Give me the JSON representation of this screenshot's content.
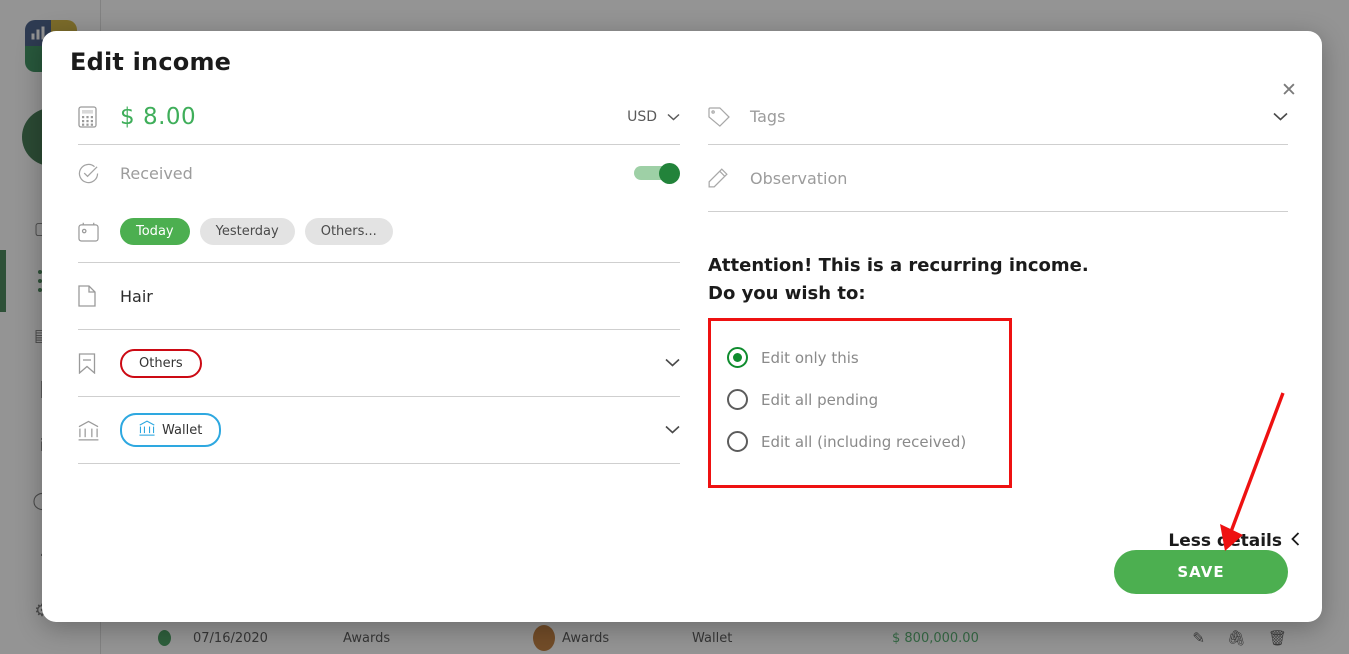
{
  "background": {
    "logo_name": "app-logo",
    "row": {
      "status_dot": "green",
      "date": "07/16/2020",
      "description": "Awards",
      "category_dot": "orange",
      "category": "Awards",
      "account": "Wallet",
      "amount": "$ 800,000.00",
      "actions": [
        "edit-icon",
        "attachment-icon",
        "delete-icon"
      ]
    }
  },
  "modal": {
    "title": "Edit income",
    "close_label": "✕",
    "left": {
      "amount": {
        "icon": "calculator-icon",
        "value": "$ 8.00",
        "currency": "USD",
        "currency_chevron": "⌄"
      },
      "received": {
        "icon": "check-circle-icon",
        "label": "Received",
        "toggle_on": true
      },
      "date": {
        "icon": "calendar-icon",
        "chips": [
          {
            "label": "Today",
            "active": true
          },
          {
            "label": "Yesterday",
            "active": false
          },
          {
            "label": "Others...",
            "active": false
          }
        ]
      },
      "description": {
        "icon": "document-icon",
        "value": "Hair"
      },
      "category": {
        "icon": "bookmark-icon",
        "value": "Others",
        "chevron": "⌄"
      },
      "account": {
        "icon": "bank-icon",
        "chip_icon": "bank-icon",
        "value": "Wallet",
        "chevron": "⌄"
      },
      "less_details": {
        "label": "Less details",
        "chevron": "‹"
      }
    },
    "right": {
      "tags": {
        "icon": "tag-icon",
        "placeholder": "Tags",
        "chevron": "⌄"
      },
      "observation": {
        "icon": "pencil-icon",
        "placeholder": "Observation"
      },
      "attention_line1": "Attention! This is a recurring income.",
      "attention_line2": "Do you wish to:",
      "options": [
        {
          "label": "Edit only this",
          "selected": true
        },
        {
          "label": "Edit all pending",
          "selected": false
        },
        {
          "label": "Edit all (including received)",
          "selected": false
        }
      ]
    },
    "save_label": "SAVE"
  },
  "colors": {
    "accent_green": "#4caf50",
    "toggle_green": "#22833a",
    "amount_green": "#3fae5a",
    "annotation_red": "#ee1111",
    "chip_red": "#cc0a14",
    "chip_blue": "#2ea8e0"
  }
}
